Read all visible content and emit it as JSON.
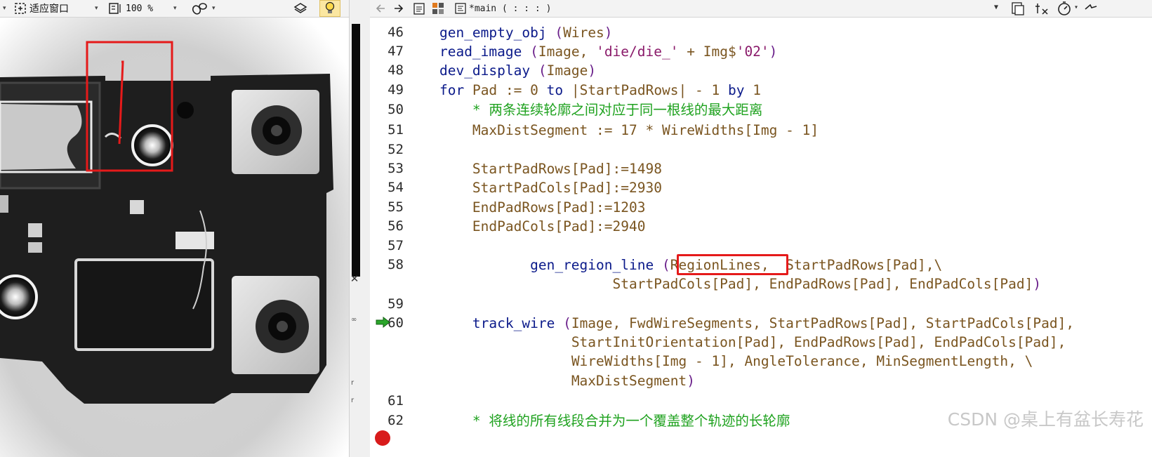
{
  "left_toolbar": {
    "fit_window_label": "适应窗口",
    "zoom_value": "100 %",
    "icons": [
      "fit-window-icon",
      "zoom-icon",
      "brush-icon",
      "layers-icon",
      "lightbulb-icon"
    ]
  },
  "right_toolbar": {
    "editor_title": "*main ( : : : )",
    "icons": [
      "back-arrow-icon",
      "forward-arrow-icon",
      "clipboard-icon",
      "grid-icon",
      "procedure-icon",
      "copy-icon",
      "clear-icon",
      "timer-icon",
      "extra-icon"
    ]
  },
  "code_lines": [
    {
      "n": "46",
      "t": "    gen_empty_obj (Wires)"
    },
    {
      "n": "47",
      "t": "    read_image (Image, 'die/die_' + Img$'02')"
    },
    {
      "n": "48",
      "t": "    dev_display (Image)"
    },
    {
      "n": "49",
      "t": "    for Pad := 0 to |StartPadRows| - 1 by 1"
    },
    {
      "n": "50",
      "t": "        * 两条连续轮廓之间对应于同一根线的最大距离"
    },
    {
      "n": "51",
      "t": "        MaxDistSegment := 17 * WireWidths[Img - 1]"
    },
    {
      "n": "52",
      "t": ""
    },
    {
      "n": "53",
      "t": "        StartPadRows[Pad]:=1498"
    },
    {
      "n": "54",
      "t": "        StartPadCols[Pad]:=2930"
    },
    {
      "n": "55",
      "t": "        EndPadRows[Pad]:=1203"
    },
    {
      "n": "56",
      "t": "        EndPadCols[Pad]:=2940"
    },
    {
      "n": "57",
      "t": ""
    },
    {
      "n": "58",
      "t": "               gen_region_line (RegionLines,  StartPadRows[Pad],\\"
    },
    {
      "n": "",
      "t": "                         StartPadCols[Pad], EndPadRows[Pad], EndPadCols[Pad])"
    },
    {
      "n": "59",
      "t": ""
    },
    {
      "n": "60",
      "t": "        track_wire (Image, FwdWireSegments, StartPadRows[Pad], StartPadCols[Pad],"
    },
    {
      "n": "",
      "t": "                    StartInitOrientation[Pad], EndPadRows[Pad], EndPadCols[Pad],"
    },
    {
      "n": "",
      "t": "                    WireWidths[Img - 1], AngleTolerance, MinSegmentLength, \\"
    },
    {
      "n": "",
      "t": "                    MaxDistSegment)"
    },
    {
      "n": "61",
      "t": ""
    },
    {
      "n": "62",
      "t": "        * 将线的所有线段合并为一个覆盖整个轨迹的长轮廓"
    }
  ],
  "watermark": "CSDN @桌上有盆长寿花",
  "colors": {
    "keyword": "#0b1a8a",
    "identifier": "#7a5520",
    "string": "#8a1a6a",
    "comment": "#1fa21f",
    "highlight": "#e51a1a",
    "arrow": "#2aa52a",
    "breakpoint": "#d81b1b"
  }
}
